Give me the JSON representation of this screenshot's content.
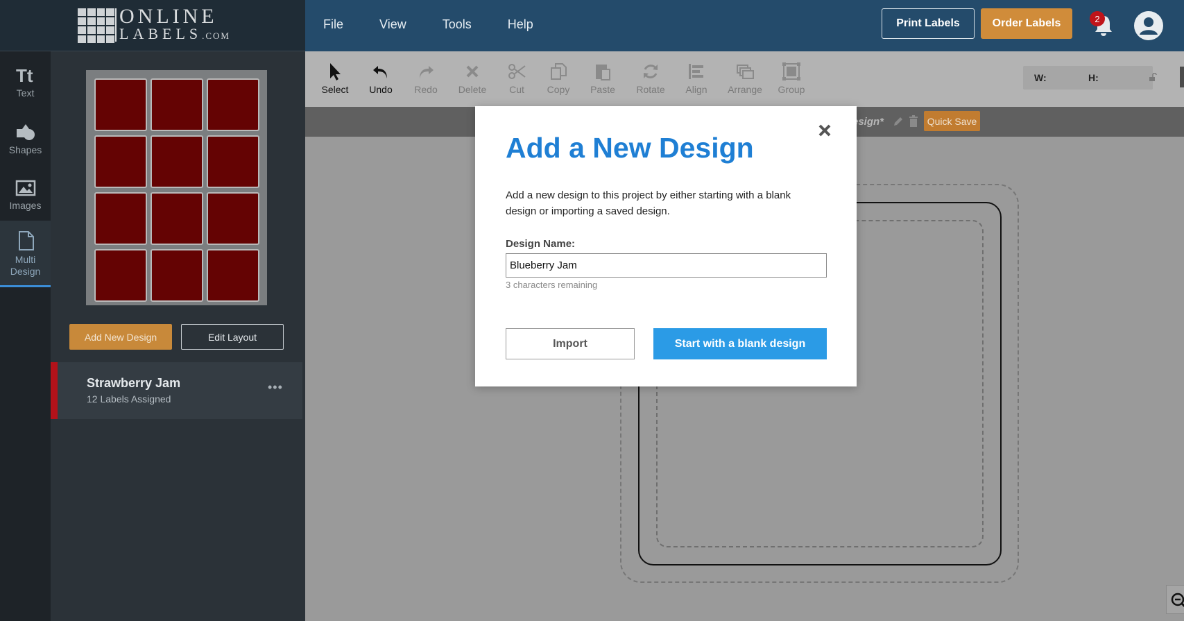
{
  "brand": {
    "line1": "ONLINE",
    "line2": "LABELS",
    "suffix": ".COM"
  },
  "menu": [
    "File",
    "View",
    "Tools",
    "Help"
  ],
  "header": {
    "print_label": "Print Labels",
    "order_label": "Order Labels",
    "notification_count": "2"
  },
  "rail": [
    {
      "label": "Text",
      "icon": "text-icon"
    },
    {
      "label": "Shapes",
      "icon": "shapes-icon"
    },
    {
      "label": "Images",
      "icon": "images-icon"
    },
    {
      "label": "Multi Design",
      "icon": "document-icon"
    }
  ],
  "panel": {
    "add_new_design": "Add New Design",
    "edit_layout": "Edit Layout",
    "design": {
      "name": "Strawberry Jam",
      "assigned": "12 Labels Assigned",
      "more": "•••"
    }
  },
  "toolbar": [
    "Select",
    "Undo",
    "Redo",
    "Delete",
    "Cut",
    "Copy",
    "Paste",
    "Rotate",
    "Align",
    "Arrange",
    "Group"
  ],
  "dimensions": {
    "w_label": "W:",
    "h_label": "H:"
  },
  "title_bar": {
    "title": "esign*",
    "quick_save": "Quick Save"
  },
  "modal": {
    "title": "Add a New Design",
    "description": "Add a new design to this project by either starting with a blank design or importing a saved design.",
    "name_label": "Design Name:",
    "name_value": "Blueberry Jam",
    "remaining": "3 characters remaining",
    "import": "Import",
    "start_blank": "Start with a blank design"
  },
  "colors": {
    "accent": "#1f7fd4",
    "primary_button": "#2b9be6",
    "orange": "#d08c3a",
    "header": "#244b6b",
    "label_fill": "#640303"
  }
}
